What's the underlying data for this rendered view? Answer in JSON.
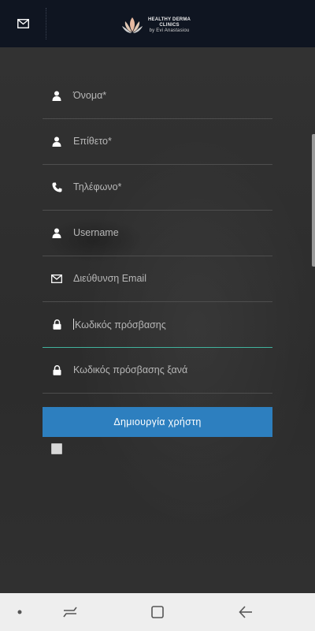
{
  "header": {
    "mail_icon": "envelope-icon",
    "logo": {
      "line1": "HEALTHY DERMA",
      "line2": "CLINICS",
      "line3": "by Evi Anastasiou",
      "icon": "lotus-icon"
    }
  },
  "form": {
    "fields": [
      {
        "placeholder": "Όνομα*",
        "icon": "person-icon"
      },
      {
        "placeholder": "Επίθετο*",
        "icon": "person-icon"
      },
      {
        "placeholder": "Τηλέφωνο*",
        "icon": "phone-icon"
      },
      {
        "placeholder": "Username",
        "icon": "person-icon"
      },
      {
        "placeholder": "Διεύθυνση Email",
        "icon": "envelope-icon"
      },
      {
        "placeholder": "Κωδικός πρόσβασης",
        "icon": "lock-icon",
        "focused": true
      },
      {
        "placeholder": "Κωδικός πρόσβασης ξανά",
        "icon": "lock-icon"
      }
    ],
    "submit_label": "Δημιουργία χρήστη",
    "checkbox_checked": false
  },
  "navbar": {
    "items": [
      "dot-icon",
      "recents-icon",
      "home-icon",
      "back-icon"
    ]
  },
  "colors": {
    "header_bg": "#0f1521",
    "button_bg": "#2d7fbf",
    "focus_underline": "#41b39d"
  }
}
